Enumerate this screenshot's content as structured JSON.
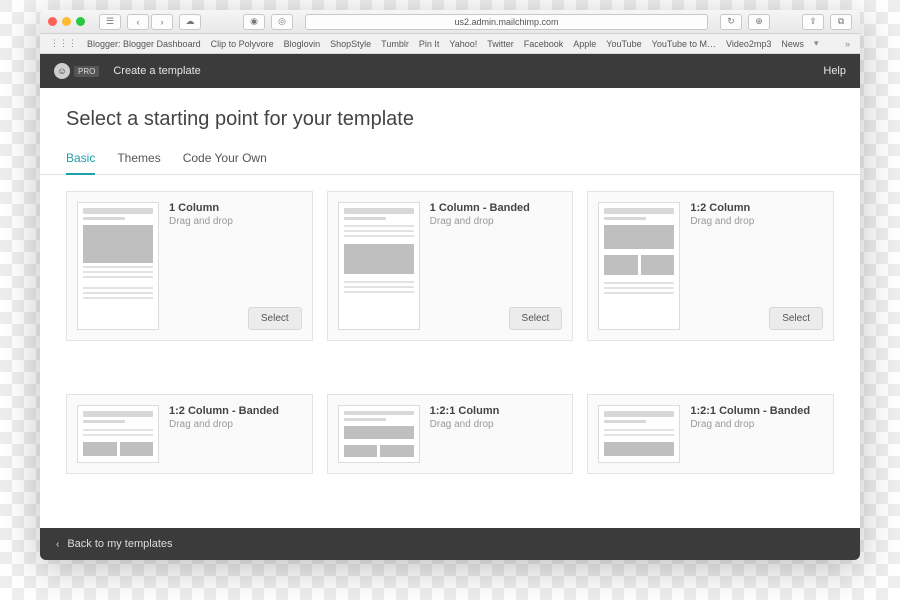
{
  "browser": {
    "url": "us2.admin.mailchimp.com",
    "bookmarks": [
      "Blogger: Blogger Dashboard",
      "Clip to Polyvore",
      "Bloglovin",
      "ShopStyle",
      "Tumblr",
      "Pin It",
      "Yahoo!",
      "Twitter",
      "Facebook",
      "Apple",
      "YouTube",
      "YouTube to M…",
      "Video2mp3",
      "News"
    ]
  },
  "header": {
    "pro": "PRO",
    "title": "Create a template",
    "help": "Help"
  },
  "page": {
    "heading": "Select a starting point for your template",
    "tabs": [
      "Basic",
      "Themes",
      "Code Your Own"
    ],
    "active_tab": 0,
    "select_label": "Select",
    "cards": [
      {
        "title": "1 Column",
        "sub": "Drag and drop"
      },
      {
        "title": "1 Column - Banded",
        "sub": "Drag and drop"
      },
      {
        "title": "1:2 Column",
        "sub": "Drag and drop"
      },
      {
        "title": "1:2 Column - Banded",
        "sub": "Drag and drop"
      },
      {
        "title": "1:2:1 Column",
        "sub": "Drag and drop"
      },
      {
        "title": "1:2:1 Column - Banded",
        "sub": "Drag and drop"
      }
    ]
  },
  "footer": {
    "back": "Back to my templates"
  }
}
